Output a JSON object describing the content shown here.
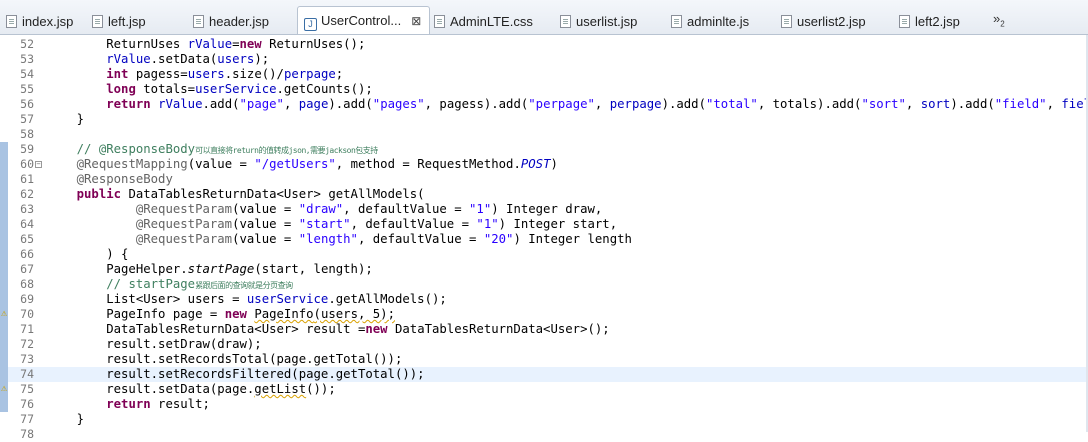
{
  "tabs": [
    {
      "label": "index.jsp",
      "active": false
    },
    {
      "label": "left.jsp",
      "active": false
    },
    {
      "label": "header.jsp",
      "active": false
    },
    {
      "label": "UserControl...",
      "active": true
    },
    {
      "label": "AdminLTE.css",
      "active": false
    },
    {
      "label": "userlist.jsp",
      "active": false
    },
    {
      "label": "adminlte.js",
      "active": false
    },
    {
      "label": "userlist2.jsp",
      "active": false
    },
    {
      "label": "left2.jsp",
      "active": false
    }
  ],
  "overflow": {
    "chevron": "»",
    "count": "2"
  },
  "close_symbol": "⊠",
  "lines": [
    {
      "num": "52",
      "segs": [
        [
          "        ReturnUses ",
          ""
        ],
        [
          "rValue",
          "fld"
        ],
        [
          "=",
          ""
        ],
        [
          "new",
          "kw"
        ],
        [
          " ReturnUses();",
          ""
        ]
      ]
    },
    {
      "num": "53",
      "segs": [
        [
          "        ",
          ""
        ],
        [
          "rValue",
          "fld"
        ],
        [
          ".setData(",
          ""
        ],
        [
          "users",
          "fld"
        ],
        [
          ");",
          ""
        ]
      ]
    },
    {
      "num": "54",
      "segs": [
        [
          "        ",
          ""
        ],
        [
          "int",
          "kw"
        ],
        [
          " pagess=",
          ""
        ],
        [
          "users",
          "fld"
        ],
        [
          ".size()/",
          ""
        ],
        [
          "perpage",
          "fld"
        ],
        [
          ";",
          ""
        ]
      ]
    },
    {
      "num": "55",
      "segs": [
        [
          "        ",
          ""
        ],
        [
          "long",
          "kw"
        ],
        [
          " totals=",
          ""
        ],
        [
          "userService",
          "fld"
        ],
        [
          ".getCounts();",
          ""
        ]
      ]
    },
    {
      "num": "56",
      "segs": [
        [
          "        ",
          ""
        ],
        [
          "return",
          "kw"
        ],
        [
          " ",
          ""
        ],
        [
          "rValue",
          "fld"
        ],
        [
          ".add(",
          ""
        ],
        [
          "\"page\"",
          "str"
        ],
        [
          ", ",
          ""
        ],
        [
          "page",
          "fld"
        ],
        [
          ").add(",
          ""
        ],
        [
          "\"pages\"",
          "str"
        ],
        [
          ", pagess).add(",
          ""
        ],
        [
          "\"perpage\"",
          "str"
        ],
        [
          ", ",
          ""
        ],
        [
          "perpage",
          "fld"
        ],
        [
          ").add(",
          ""
        ],
        [
          "\"total\"",
          "str"
        ],
        [
          ", totals).add(",
          ""
        ],
        [
          "\"sort\"",
          "str"
        ],
        [
          ", ",
          ""
        ],
        [
          "sort",
          "fld"
        ],
        [
          ").add(",
          ""
        ],
        [
          "\"field\"",
          "str"
        ],
        [
          ", ",
          ""
        ],
        [
          "field",
          "fld"
        ],
        [
          ");",
          ""
        ]
      ]
    },
    {
      "num": "57",
      "segs": [
        [
          "    }",
          ""
        ]
      ]
    },
    {
      "num": "58",
      "segs": [
        [
          "",
          ""
        ]
      ]
    },
    {
      "num": "59",
      "segs": [
        [
          "    ",
          ""
        ],
        [
          "// @ResponseBody",
          "cm"
        ],
        [
          "可以直接将return的值转成json,需要jackson包支持",
          "cm cjk"
        ]
      ]
    },
    {
      "num": "60",
      "fold": true,
      "segs": [
        [
          "    ",
          ""
        ],
        [
          "@RequestMapping",
          "ann"
        ],
        [
          "(value = ",
          ""
        ],
        [
          "\"/getUsers\"",
          "str"
        ],
        [
          ", method = RequestMethod.",
          ""
        ],
        [
          "POST",
          "fld it"
        ],
        [
          ")",
          ""
        ]
      ]
    },
    {
      "num": "61",
      "segs": [
        [
          "    ",
          ""
        ],
        [
          "@ResponseBody",
          "ann"
        ]
      ]
    },
    {
      "num": "62",
      "segs": [
        [
          "    ",
          ""
        ],
        [
          "public",
          "kw"
        ],
        [
          " DataTablesReturnData<User> getAllModels(",
          ""
        ]
      ]
    },
    {
      "num": "63",
      "segs": [
        [
          "            ",
          ""
        ],
        [
          "@RequestParam",
          "ann"
        ],
        [
          "(value = ",
          ""
        ],
        [
          "\"draw\"",
          "str"
        ],
        [
          ", defaultValue = ",
          ""
        ],
        [
          "\"1\"",
          "str"
        ],
        [
          ") Integer draw,",
          ""
        ]
      ]
    },
    {
      "num": "64",
      "segs": [
        [
          "            ",
          ""
        ],
        [
          "@RequestParam",
          "ann"
        ],
        [
          "(value = ",
          ""
        ],
        [
          "\"start\"",
          "str"
        ],
        [
          ", defaultValue = ",
          ""
        ],
        [
          "\"1\"",
          "str"
        ],
        [
          ") Integer start,",
          ""
        ]
      ]
    },
    {
      "num": "65",
      "segs": [
        [
          "            ",
          ""
        ],
        [
          "@RequestParam",
          "ann"
        ],
        [
          "(value = ",
          ""
        ],
        [
          "\"length\"",
          "str"
        ],
        [
          ", defaultValue = ",
          ""
        ],
        [
          "\"20\"",
          "str"
        ],
        [
          ") Integer length",
          ""
        ]
      ]
    },
    {
      "num": "66",
      "segs": [
        [
          "        ) {",
          ""
        ]
      ]
    },
    {
      "num": "67",
      "segs": [
        [
          "        PageHelper.",
          ""
        ],
        [
          "startPage",
          "it"
        ],
        [
          "(start, length);",
          ""
        ]
      ]
    },
    {
      "num": "68",
      "segs": [
        [
          "        ",
          ""
        ],
        [
          "// startPage",
          "cm"
        ],
        [
          "紧跟后面的查询就是分页查询",
          "cm cjk"
        ]
      ]
    },
    {
      "num": "69",
      "segs": [
        [
          "        List<User> users = ",
          ""
        ],
        [
          "userService",
          "fld"
        ],
        [
          ".getAllModels();",
          ""
        ]
      ]
    },
    {
      "num": "70",
      "warn": true,
      "segs": [
        [
          "        PageInfo page = ",
          ""
        ],
        [
          "new",
          "kw"
        ],
        [
          " ",
          ""
        ],
        [
          "PageInfo",
          "sq"
        ],
        [
          "(users, 5);",
          "sq"
        ]
      ]
    },
    {
      "num": "71",
      "segs": [
        [
          "        DataTablesReturnData<User> result =",
          ""
        ],
        [
          "new",
          "kw"
        ],
        [
          " DataTablesReturnData<User>();",
          ""
        ]
      ]
    },
    {
      "num": "72",
      "segs": [
        [
          "        result.setDraw(draw);",
          ""
        ]
      ]
    },
    {
      "num": "73",
      "segs": [
        [
          "        result.setRecordsTotal(page.getTotal());",
          ""
        ]
      ]
    },
    {
      "num": "74",
      "current": true,
      "segs": [
        [
          "        result.setRecordsFiltered(page.getTotal());",
          ""
        ]
      ]
    },
    {
      "num": "75",
      "warn": true,
      "segs": [
        [
          "        result.setData(page.",
          ""
        ],
        [
          "getList",
          "sq"
        ],
        [
          "());",
          ""
        ]
      ]
    },
    {
      "num": "76",
      "segs": [
        [
          "        ",
          ""
        ],
        [
          "return",
          "kw"
        ],
        [
          " result;",
          ""
        ]
      ]
    },
    {
      "num": "77",
      "segs": [
        [
          "    }",
          ""
        ]
      ]
    },
    {
      "num": "78",
      "segs": [
        [
          "",
          ""
        ]
      ]
    }
  ]
}
